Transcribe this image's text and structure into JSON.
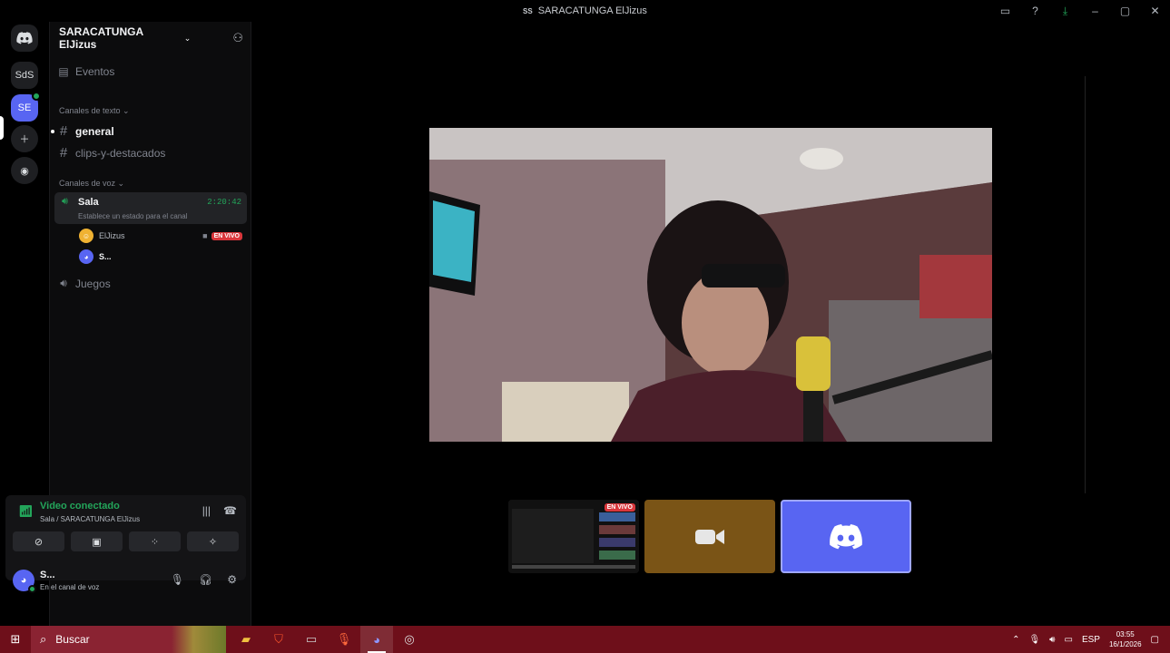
{
  "window": {
    "title": "SARACATUNGA ElJizus",
    "server_badge": "SS"
  },
  "rail": {
    "items": [
      "SdS",
      "SE"
    ]
  },
  "server": {
    "name": "SARACATUNGA ElJizus"
  },
  "sidebar": {
    "events": "Eventos",
    "text_category": "Canales de texto",
    "text_channels": [
      "general",
      "clips-y-destacados"
    ],
    "voice_category": "Canales de voz",
    "voice_channel": {
      "name": "Sala",
      "timer": "2:20:42",
      "status": "Establece un estado para el canal"
    },
    "members": [
      {
        "name": "ElJizus",
        "badge": "EN VIVO"
      },
      {
        "name": "S..."
      }
    ],
    "other_voice": "Juegos"
  },
  "voice_panel": {
    "status": "Video conectado",
    "subtitle": "Sala / SARACATUNGA ElJizus"
  },
  "user_panel": {
    "name": "S...",
    "status": "En el canal de voz"
  },
  "stage": {
    "live_badge": "EN VIVO"
  },
  "taskbar": {
    "search": "Buscar",
    "lang": "ESP",
    "time": "03:55",
    "date": "16/1/2026"
  },
  "colors": {
    "accent": "#5865f2",
    "green": "#23a55a",
    "live": "#da373c",
    "taskbar": "#6e0f1a"
  }
}
